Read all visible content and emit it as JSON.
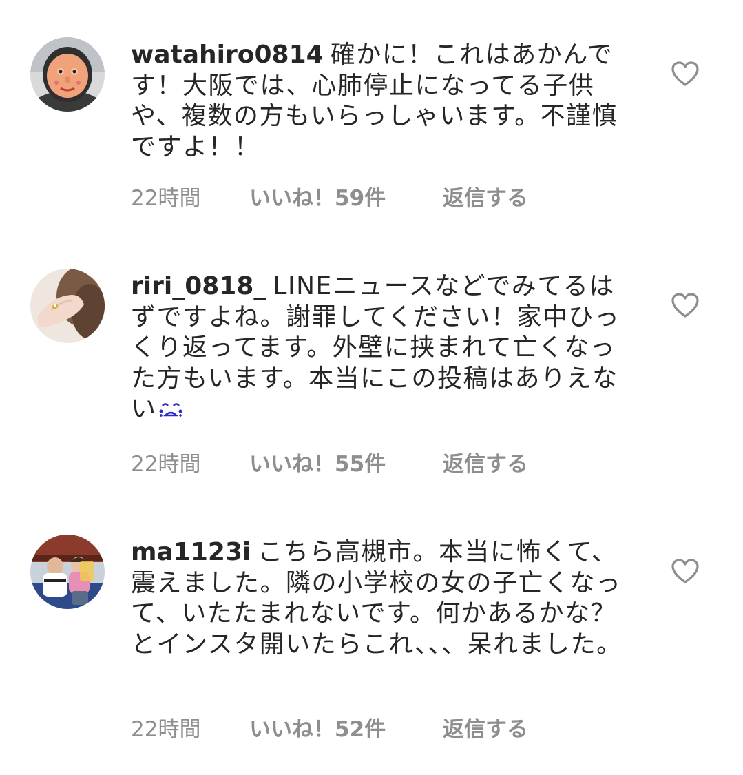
{
  "comments": [
    {
      "username": "watahiro0814",
      "text": "確かに！これはあかんです！大阪では、心肺停止になってる子供や、複数の方もいらっしゃいます。不謹慎ですよ！！",
      "time": "22時間",
      "likes": "いいね！59件",
      "reply": "返信する",
      "avatar": "cartoon-face-avatar",
      "emoji": ""
    },
    {
      "username": "riri_0818_",
      "text": "LINEニュースなどでみてるはずですよね。謝罪してください！家中ひっくり返ってます。外壁に挟まれて亡くなった方もいます。本当にこの投稿はありえない",
      "time": "22時間",
      "likes": "いいね！55件",
      "reply": "返信する",
      "avatar": "hand-with-ring-avatar",
      "emoji": "crying-face-emoji"
    },
    {
      "username": "ma1123i",
      "text": "こちら高槻市。本当に怖くて、震えました。隣の小学校の女の子亡くなって、いたたまれないです。何かあるかな？とインスタ開いたらこれ、、、呆れました。",
      "time": "22時間",
      "likes": "いいね！52件",
      "reply": "返信する",
      "avatar": "family-photo-avatar",
      "emoji": ""
    }
  ],
  "colors": {
    "text": "#262626",
    "meta": "#8e8e8e",
    "heart": "#8e8e8e",
    "emoji": "#2b2bc4"
  },
  "icons": {
    "like": "heart-outline-icon"
  }
}
